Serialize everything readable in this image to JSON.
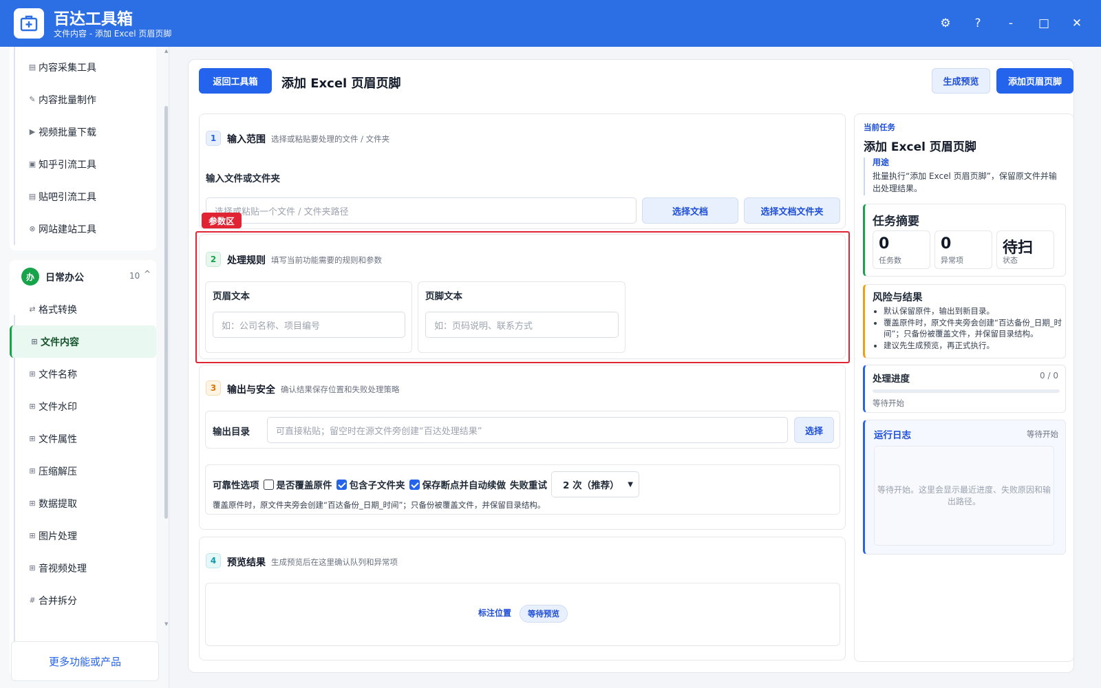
{
  "app": {
    "title": "百达工具箱",
    "subtitle": "文件内容 - 添加 Excel 页眉页脚"
  },
  "window": {
    "settings": "⚙",
    "help": "?",
    "minimize": "-",
    "maximize": "□",
    "close": "✕"
  },
  "sidebar": {
    "group1_items": [
      {
        "label": "内容采集工具",
        "icon": "doc-icon",
        "glyph": "▤"
      },
      {
        "label": "内容批量制作",
        "icon": "pen-icon",
        "glyph": "✎"
      },
      {
        "label": "视频批量下载",
        "icon": "video-icon",
        "glyph": "▶"
      },
      {
        "label": "知乎引流工具",
        "icon": "zhihu-icon",
        "glyph": "▣"
      },
      {
        "label": "贴吧引流工具",
        "icon": "tieba-icon",
        "glyph": "▤"
      },
      {
        "label": "网站建站工具",
        "icon": "web-icon",
        "glyph": "⊗"
      }
    ],
    "group2": {
      "badge": "办",
      "title": "日常办公",
      "count": "10",
      "chevron": "^"
    },
    "group2_items": [
      {
        "label": "格式转换",
        "icon": "convert-icon",
        "glyph": "⇄"
      },
      {
        "label": "文件内容",
        "icon": "grid-icon",
        "glyph": "⊞"
      },
      {
        "label": "文件名称",
        "icon": "grid-icon",
        "glyph": "⊞"
      },
      {
        "label": "文件水印",
        "icon": "grid-icon",
        "glyph": "⊞"
      },
      {
        "label": "文件属性",
        "icon": "grid-icon",
        "glyph": "⊞"
      },
      {
        "label": "压缩解压",
        "icon": "grid-icon",
        "glyph": "⊞"
      },
      {
        "label": "数据提取",
        "icon": "grid-icon",
        "glyph": "⊞"
      },
      {
        "label": "图片处理",
        "icon": "grid-icon",
        "glyph": "⊞"
      },
      {
        "label": "音视频处理",
        "icon": "grid-icon",
        "glyph": "⊞"
      },
      {
        "label": "合并拆分",
        "icon": "hash-icon",
        "glyph": "#"
      }
    ],
    "more": "更多功能或产品"
  },
  "header": {
    "back": "返回工具箱",
    "title": "添加 Excel 页眉页脚",
    "preview": "生成预览",
    "run": "添加页眉页脚"
  },
  "section1": {
    "num": "1",
    "title": "输入范围",
    "desc": "选择或粘贴要处理的文件 / 文件夹",
    "field_label": "输入文件或文件夹",
    "placeholder": "选择或粘贴一个文件 / 文件夹路径",
    "btn_file": "选择文档",
    "btn_folder": "选择文档文件夹"
  },
  "param_tag": "参数区",
  "section2": {
    "num": "2",
    "title": "处理规则",
    "desc": "填写当前功能需要的规则和参数",
    "header_label": "页眉文本",
    "header_placeholder": "如：公司名称、项目编号",
    "footer_label": "页脚文本",
    "footer_placeholder": "如：页码说明、联系方式"
  },
  "section3": {
    "num": "3",
    "title": "输出与安全",
    "desc": "确认结果保存位置和失败处理策略",
    "out_label": "输出目录",
    "out_placeholder": "可直接粘贴；留空时在源文件旁创建“百达处理结果”",
    "out_btn": "选择",
    "rel_label": "可靠性选项",
    "opt1": "是否覆盖原件",
    "opt2": "包含子文件夹",
    "opt3": "保存断点并自动续做",
    "retry_label": "失败重试",
    "retry_value": "2 次（推荐）",
    "note": "覆盖原件时，原文件夹旁会创建“百达备份_日期_时间”；只备份被覆盖文件，并保留目录结构。"
  },
  "section4": {
    "num": "4",
    "title": "预览结果",
    "desc": "生成预览后在这里确认队列和异常项",
    "mark": "标注位置",
    "badge": "等待预览"
  },
  "right": {
    "label": "当前任务",
    "title": "添加 Excel 页眉页脚",
    "use_label": "用途",
    "use_text": "批量执行“添加 Excel 页眉页脚”，保留原文件并输出处理结果。",
    "summary_title": "任务摘要",
    "stats": [
      {
        "value": "0",
        "label": "任务数"
      },
      {
        "value": "0",
        "label": "异常项"
      },
      {
        "value": "待扫",
        "label": "状态"
      }
    ],
    "risk_title": "风险与结果",
    "risks": [
      "默认保留原件，输出到新目录。",
      "覆盖原件时，原文件夹旁会创建“百达备份_日期_时间”；只备份被覆盖文件，并保留目录结构。",
      "建议先生成预览，再正式执行。"
    ],
    "progress_title": "处理进度",
    "progress_count": "0 / 0",
    "progress_value": 0,
    "progress_status": "等待开始",
    "log_title": "运行日志",
    "log_status": "等待开始",
    "log_text": "等待开始。这里会显示最近进度、失败原因和输出路径。"
  },
  "colors": {
    "primary": "#2463eb",
    "titlebar": "#2c6ee3",
    "highlight": "#e02433",
    "success": "#16a34a",
    "warning": "#f59e0b"
  }
}
